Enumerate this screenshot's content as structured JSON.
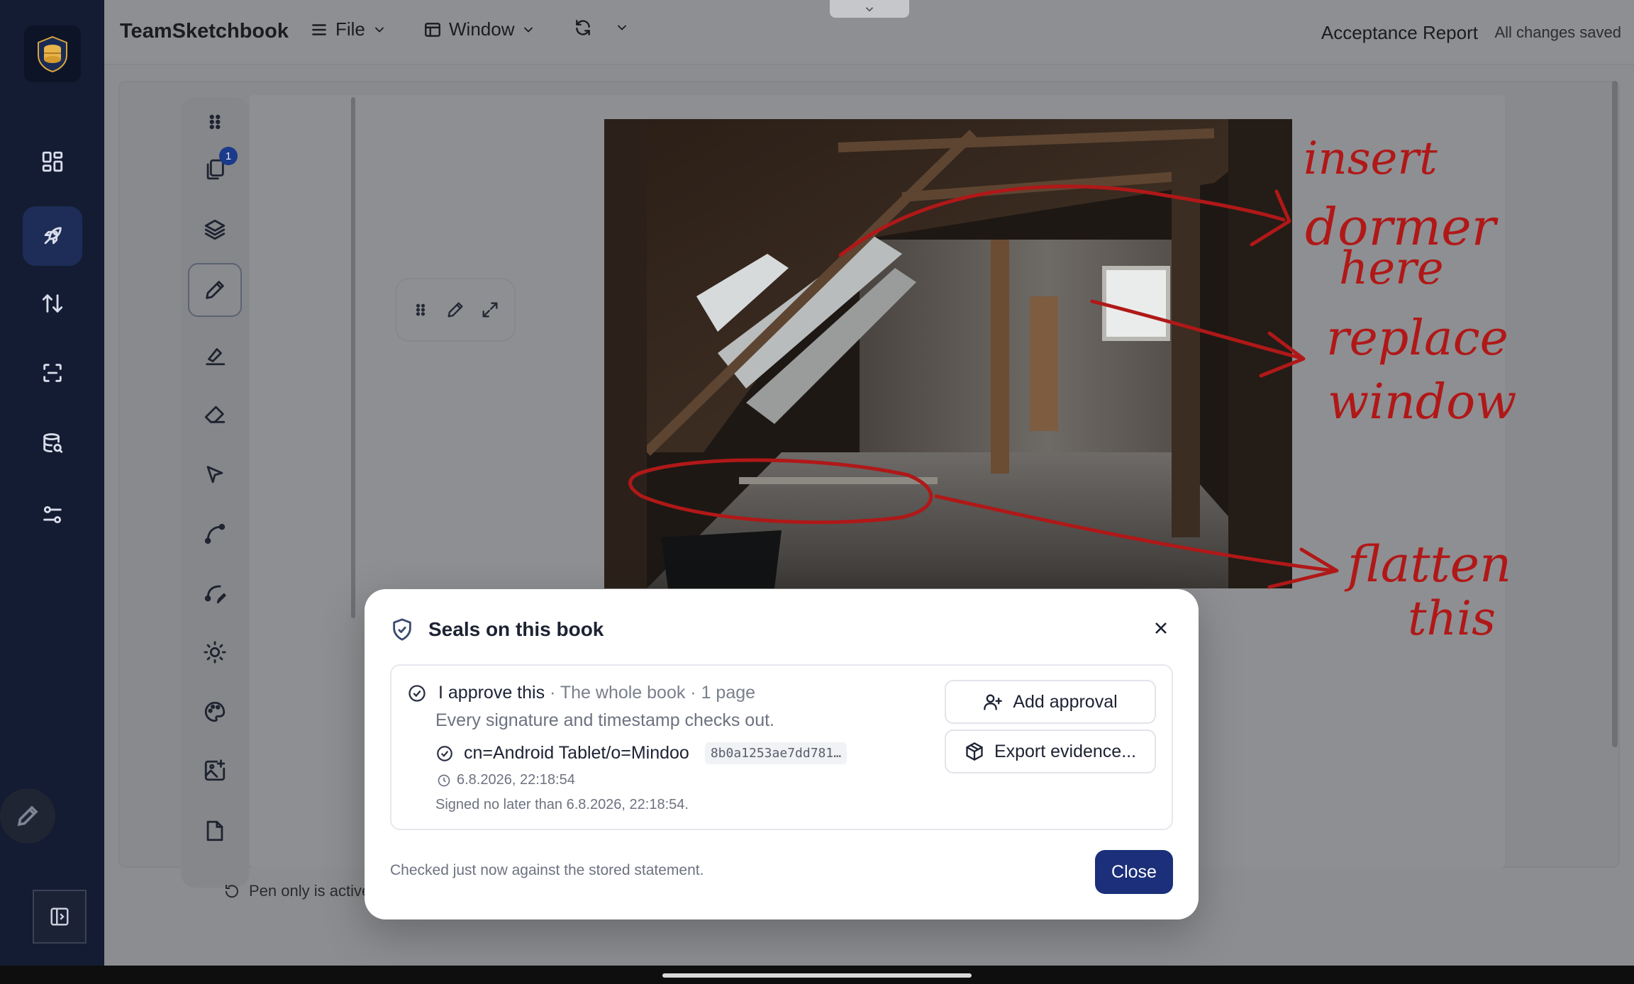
{
  "app": {
    "name": "TeamSketchbook",
    "doc_title": "Acceptance Report",
    "save_status": "All changes saved"
  },
  "menus": [
    {
      "label": "File",
      "icon": "menu-icon"
    },
    {
      "label": "Window",
      "icon": "window-icon"
    }
  ],
  "sidebar": {
    "items": [
      {
        "name": "dashboard",
        "icon": "grid-icon"
      },
      {
        "name": "launch",
        "icon": "rocket-icon",
        "active": true
      },
      {
        "name": "sync",
        "icon": "arrows-updown-icon"
      },
      {
        "name": "scan",
        "icon": "scan-icon"
      },
      {
        "name": "database",
        "icon": "database-search-icon"
      },
      {
        "name": "settings",
        "icon": "sliders-icon"
      }
    ]
  },
  "toolstrip": {
    "pages_badge": "1",
    "tools": [
      "drag-handle-icon",
      "pages-icon",
      "layers-icon",
      "pen-icon",
      "highlighter-icon",
      "eraser-icon",
      "pointer-icon",
      "curve-icon",
      "curve-edit-icon",
      "brightness-icon",
      "palette-icon",
      "image-add-icon",
      "page-icon"
    ]
  },
  "annotations": {
    "note1": [
      "insert",
      "dormer",
      "here"
    ],
    "note2": [
      "replace",
      "window"
    ],
    "note3": [
      "flatten",
      "this"
    ],
    "ink_color": "#b01818"
  },
  "status_line": "Pen only is active: fingers do not draw",
  "modal": {
    "title": "Seals on this book",
    "seal": {
      "name": "I approve this",
      "meta": " · The whole book · 1 page",
      "check": "Every signature and timestamp checks out.",
      "signer": "cn=Android Tablet/o=Mindoo",
      "hash": "8b0a1253ae7dd781…",
      "time": "6.8.2026, 22:18:54",
      "signed_note": "Signed no later than 6.8.2026, 22:18:54."
    },
    "buttons": {
      "add_approval": "Add approval",
      "export_evidence": "Export evidence...",
      "close": "Close"
    },
    "footer": "Checked just now against the stored statement.",
    "accent": "#1b2f7a"
  }
}
